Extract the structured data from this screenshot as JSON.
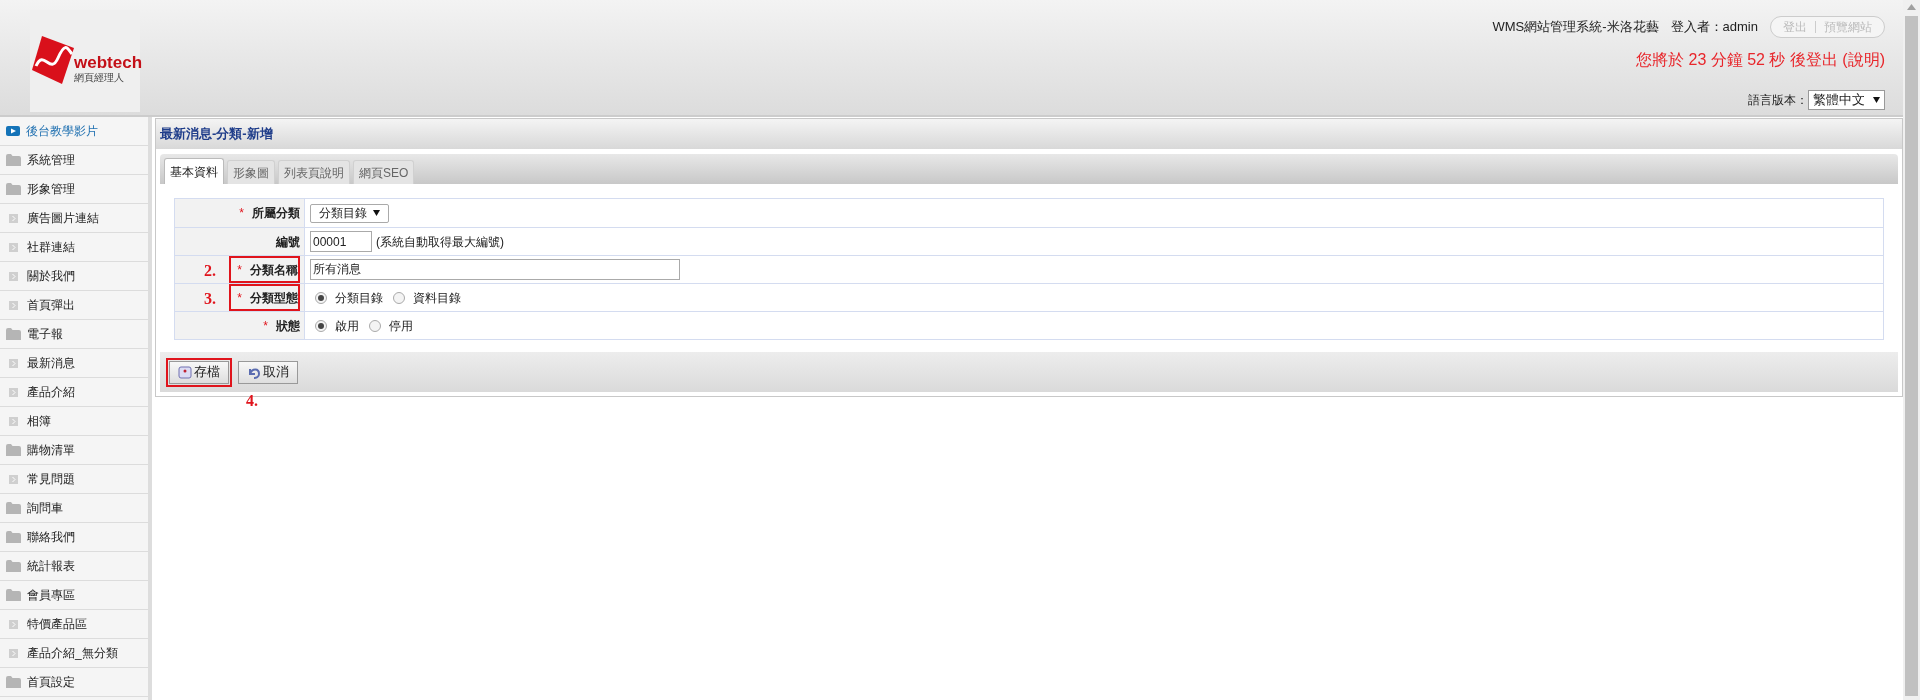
{
  "logo": {
    "brand": "webtech",
    "subtitle": "網頁經理人"
  },
  "header": {
    "system": "WMS網站管理系統-米洛花藝",
    "user_label": "登入者：admin",
    "buttons": [
      "登出",
      "預覽網站"
    ],
    "countdown": "您將於 23 分鐘 52 秒 後登出 (說明)",
    "language_label": "語言版本：",
    "language": "繁體中文"
  },
  "sidebar": {
    "items": [
      {
        "label": "後台教學影片",
        "kind": "video"
      },
      {
        "label": "系統管理",
        "kind": "folder"
      },
      {
        "label": "形象管理",
        "kind": "folder"
      },
      {
        "label": "廣告圖片連結",
        "kind": "page"
      },
      {
        "label": "社群連結",
        "kind": "page"
      },
      {
        "label": "關於我們",
        "kind": "page"
      },
      {
        "label": "首頁彈出",
        "kind": "page"
      },
      {
        "label": "電子報",
        "kind": "folder"
      },
      {
        "label": "最新消息",
        "kind": "page"
      },
      {
        "label": "產品介紹",
        "kind": "page"
      },
      {
        "label": "相簿",
        "kind": "page"
      },
      {
        "label": "購物清單",
        "kind": "folder"
      },
      {
        "label": "常見問題",
        "kind": "page"
      },
      {
        "label": "詢問車",
        "kind": "folder"
      },
      {
        "label": "聯絡我們",
        "kind": "folder"
      },
      {
        "label": "統計報表",
        "kind": "folder"
      },
      {
        "label": "會員專區",
        "kind": "folder"
      },
      {
        "label": "特價產品區",
        "kind": "page"
      },
      {
        "label": "產品介紹_無分類",
        "kind": "page"
      },
      {
        "label": "首頁設定",
        "kind": "folder"
      }
    ]
  },
  "panel": {
    "title": "最新消息-分類-新增",
    "required_mark": "*",
    "tabs": [
      {
        "label": "基本資料",
        "selected": true
      },
      {
        "label": "形象圖",
        "selected": false
      },
      {
        "label": "列表頁說明",
        "selected": false
      },
      {
        "label": "網頁SEO",
        "selected": false
      }
    ],
    "rows": [
      {
        "label": "所屬分類",
        "required": true,
        "kind": "select",
        "value": "分類目錄"
      },
      {
        "label": "編號",
        "required": false,
        "kind": "text",
        "value": "00001",
        "note": "(系統自動取得最大編號)"
      },
      {
        "label": "分類名稱",
        "required": true,
        "kind": "wide_text",
        "value": "所有消息",
        "annotation": "2."
      },
      {
        "label": "分類型態",
        "required": true,
        "kind": "radio",
        "options": [
          {
            "label": "分類目錄",
            "selected": true
          },
          {
            "label": "資料目錄",
            "selected": false
          }
        ],
        "annotation": "3."
      },
      {
        "label": "狀態",
        "required": true,
        "kind": "radio",
        "options": [
          {
            "label": "啟用",
            "selected": true
          },
          {
            "label": "停用",
            "selected": false
          }
        ]
      }
    ],
    "buttons": [
      {
        "label": "存檔",
        "kind": "save",
        "annotation": "4."
      },
      {
        "label": "取消",
        "kind": "cancel"
      }
    ]
  }
}
